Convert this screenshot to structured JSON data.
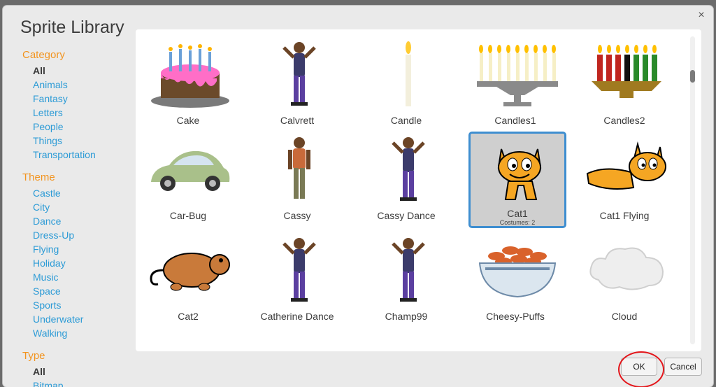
{
  "dialog": {
    "title": "Sprite Library",
    "close_glyph": "×"
  },
  "sidebar": {
    "category": {
      "heading": "Category",
      "items": [
        "All",
        "Animals",
        "Fantasy",
        "Letters",
        "People",
        "Things",
        "Transportation"
      ],
      "selected": "All"
    },
    "theme": {
      "heading": "Theme",
      "items": [
        "Castle",
        "City",
        "Dance",
        "Dress-Up",
        "Flying",
        "Holiday",
        "Music",
        "Space",
        "Sports",
        "Underwater",
        "Walking"
      ]
    },
    "type": {
      "heading": "Type",
      "items": [
        "All",
        "Bitmap"
      ],
      "selected": "All"
    }
  },
  "sprites": [
    {
      "name": "Cake",
      "icon": "cake-icon"
    },
    {
      "name": "Calvrett",
      "icon": "dancer-icon"
    },
    {
      "name": "Candle",
      "icon": "candle-icon"
    },
    {
      "name": "Candles1",
      "icon": "menorah-icon"
    },
    {
      "name": "Candles2",
      "icon": "kinara-icon"
    },
    {
      "name": "Car-Bug",
      "icon": "car-icon"
    },
    {
      "name": "Cassy",
      "icon": "person-icon"
    },
    {
      "name": "Cassy Dance",
      "icon": "dancer-icon"
    },
    {
      "name": "Cat1",
      "icon": "cat-icon",
      "sub": "Costumes: 2",
      "selected": true
    },
    {
      "name": "Cat1 Flying",
      "icon": "cat-flying-icon"
    },
    {
      "name": "Cat2",
      "icon": "hamster-icon"
    },
    {
      "name": "Catherine Dance",
      "icon": "dancer-icon"
    },
    {
      "name": "Champ99",
      "icon": "dancer-icon"
    },
    {
      "name": "Cheesy-Puffs",
      "icon": "bowl-icon"
    },
    {
      "name": "Cloud",
      "icon": "cloud-icon"
    }
  ],
  "footer": {
    "ok_label": "OK",
    "cancel_label": "Cancel"
  },
  "colors": {
    "accent": "#3e8ed0",
    "category_heading": "#f2941f",
    "link": "#2c9bd6",
    "highlight_ring": "#e3161b"
  }
}
